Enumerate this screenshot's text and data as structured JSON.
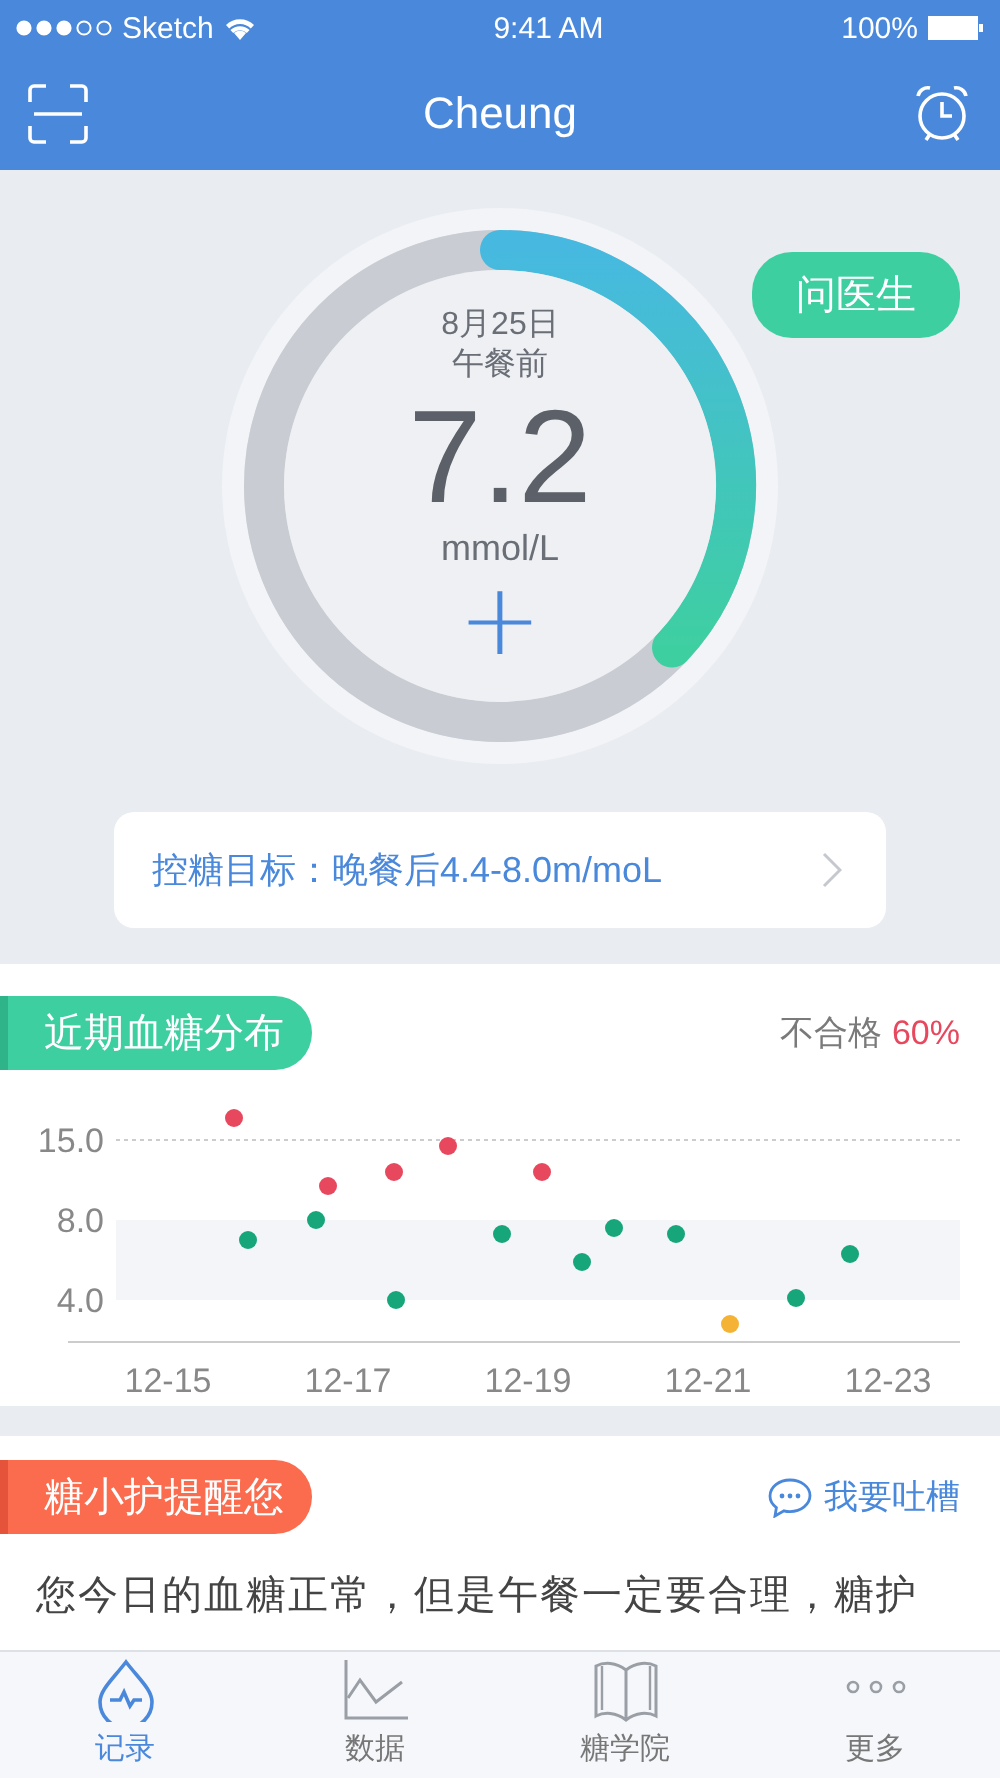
{
  "status_bar": {
    "carrier": "Sketch",
    "time": "9:41 AM",
    "battery": "100%"
  },
  "nav": {
    "title": "Cheung"
  },
  "reading": {
    "date": "8月25日",
    "meal": "午餐前",
    "value": "7.2",
    "unit": "mmol/L",
    "add": "+"
  },
  "ask_button": "问医生",
  "target": {
    "label": "控糖目标：晚餐后4.4-8.0m/moL"
  },
  "distribution": {
    "title": "近期血糖分布",
    "fail_label": "不合格",
    "fail_rate": "60%",
    "y_labels": [
      "15.0",
      "8.0",
      "4.0"
    ],
    "x_labels": [
      "12-15",
      "12-17",
      "12-19",
      "12-21",
      "12-23"
    ]
  },
  "reminder": {
    "title": "糖小护提醒您",
    "feedback": "我要吐槽",
    "message": "您今日的血糖正常，但是午餐一定要合理，糖护"
  },
  "tabs": [
    {
      "label": "记录",
      "selected": true
    },
    {
      "label": "数据",
      "selected": false
    },
    {
      "label": "糖学院",
      "selected": false
    },
    {
      "label": "更多",
      "selected": false
    }
  ]
}
